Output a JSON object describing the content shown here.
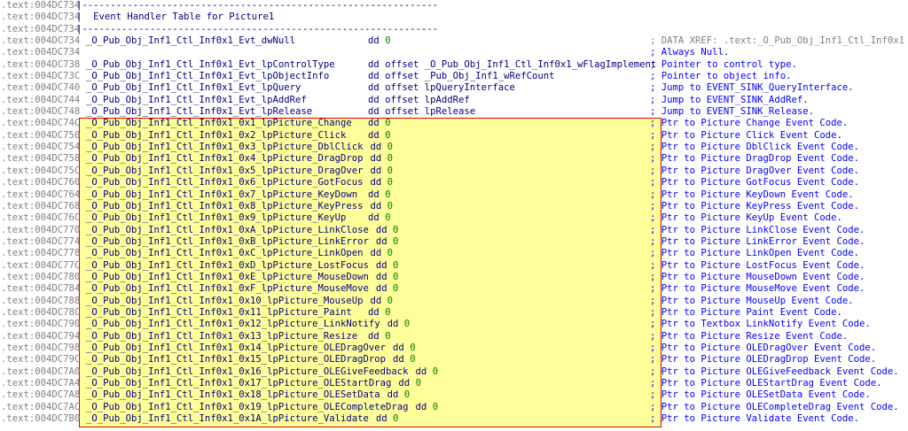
{
  "header": {
    "top_rule": "|---------------------------------------------------------------",
    "title": "|  Event Handler Table for Picture1",
    "bottom_rule": "|---------------------------------------------------------------"
  },
  "rows": [
    {
      "addr": ".text:004DC734",
      "kind": "rule",
      "text": "|---------------------------------------------------------------"
    },
    {
      "addr": ".text:004DC734",
      "kind": "rule",
      "text": "|  Event Handler Table for Picture1"
    },
    {
      "addr": ".text:004DC734",
      "kind": "rule",
      "text": "|---------------------------------------------------------------"
    },
    {
      "addr": ".text:004DC734",
      "kind": "code",
      "label": "_O_Pub_Obj_Inf1_Ctl_Inf0x1_Evt_dwNull",
      "op": "dd ",
      "num": "0",
      "operand": "",
      "comment": "; DATA XREF: .text:_O_Pub_Obj_Inf1_Ctl_Inf0x1",
      "comment_style": "xref"
    },
    {
      "addr": ".text:004DC734",
      "kind": "code",
      "label": "",
      "op": "",
      "num": "",
      "operand": "",
      "comment": "; Always Null.",
      "comment_style": "normal"
    },
    {
      "addr": ".text:004DC738",
      "kind": "code",
      "label": "_O_Pub_Obj_Inf1_Ctl_Inf0x1_Evt_lpControlType",
      "op": "dd offset _O_Pub_Obj_Inf1_Ctl_Inf0x1_wFlagImplement",
      "num": "",
      "operand": "",
      "comment": "; Pointer to control type.",
      "comment_style": "normal"
    },
    {
      "addr": ".text:004DC73C",
      "kind": "code",
      "label": "_O_Pub_Obj_Inf1_Ctl_Inf0x1_Evt_lpObjectInfo",
      "op": "dd offset _Pub_Obj_Inf1_wRefCount",
      "num": "",
      "operand": "",
      "comment": "; Pointer to object info.",
      "comment_style": "normal"
    },
    {
      "addr": ".text:004DC740",
      "kind": "code",
      "label": "_O_Pub_Obj_Inf1_Ctl_Inf0x1_Evt_lpQuery",
      "op": "dd offset lpQueryInterface",
      "num": "",
      "operand": "",
      "comment": "; Jump to EVENT_SINK_QueryInterface.",
      "comment_style": "normal"
    },
    {
      "addr": ".text:004DC744",
      "kind": "code",
      "label": "_O_Pub_Obj_Inf1_Ctl_Inf0x1_Evt_lpAddRef",
      "op": "dd offset lpAddRef",
      "num": "",
      "operand": "",
      "comment": "; Jump to EVENT_SINK_AddRef.",
      "comment_style": "normal"
    },
    {
      "addr": ".text:004DC748",
      "kind": "code",
      "label": "_O_Pub_Obj_Inf1_Ctl_Inf0x1_Evt_lpRelease",
      "op": "dd offset lpRelease",
      "num": "",
      "operand": "",
      "comment": "; Jump to EVENT_SINK_Release.",
      "comment_style": "normal"
    },
    {
      "addr": ".text:004DC74C",
      "kind": "hl",
      "label": "_O_Pub_Obj_Inf1_Ctl_Inf0x1_0x1_lpPicture_Change",
      "op": "dd ",
      "num": "0",
      "comment": "; Ptr to Picture Change Event Code."
    },
    {
      "addr": ".text:004DC750",
      "kind": "hl",
      "label": "_O_Pub_Obj_Inf1_Ctl_Inf0x1_0x2_lpPicture_Click",
      "op": "dd ",
      "num": "0",
      "comment": "; Ptr to Picture Click Event Code."
    },
    {
      "addr": ".text:004DC754",
      "kind": "hl",
      "label": "_O_Pub_Obj_Inf1_Ctl_Inf0x1_0x3_lpPicture_DblClick",
      "op": "dd ",
      "num": "0",
      "comment": "; Ptr to Picture DblClick Event Code."
    },
    {
      "addr": ".text:004DC758",
      "kind": "hl",
      "label": "_O_Pub_Obj_Inf1_Ctl_Inf0x1_0x4_lpPicture_DragDrop",
      "op": "dd ",
      "num": "0",
      "comment": "; Ptr to Picture DragDrop Event Code."
    },
    {
      "addr": ".text:004DC75C",
      "kind": "hl",
      "label": "_O_Pub_Obj_Inf1_Ctl_Inf0x1_0x5_lpPicture_DragOver",
      "op": "dd ",
      "num": "0",
      "comment": "; Ptr to Picture DragOver Event Code."
    },
    {
      "addr": ".text:004DC760",
      "kind": "hl",
      "label": "_O_Pub_Obj_Inf1_Ctl_Inf0x1_0x6_lpPicture_GotFocus",
      "op": "dd ",
      "num": "0",
      "comment": "; Ptr to Picture GotFocus Event Code."
    },
    {
      "addr": ".text:004DC764",
      "kind": "hl",
      "label": "_O_Pub_Obj_Inf1_Ctl_Inf0x1_0x7_lpPicture_KeyDown",
      "op": "dd ",
      "num": "0",
      "comment": "; Ptr to Picture KeyDown Event Code."
    },
    {
      "addr": ".text:004DC768",
      "kind": "hl",
      "label": "_O_Pub_Obj_Inf1_Ctl_Inf0x1_0x8_lpPicture_KeyPress",
      "op": "dd ",
      "num": "0",
      "comment": "; Ptr to Picture KeyPress Event Code."
    },
    {
      "addr": ".text:004DC76C",
      "kind": "hl",
      "label": "_O_Pub_Obj_Inf1_Ctl_Inf0x1_0x9_lpPicture_KeyUp",
      "op": "dd ",
      "num": "0",
      "comment": "; Ptr to Picture KeyUp Event Code."
    },
    {
      "addr": ".text:004DC770",
      "kind": "hl",
      "label": "_O_Pub_Obj_Inf1_Ctl_Inf0x1_0xA_lpPicture_LinkClose",
      "op": "dd ",
      "num": "0",
      "comment": "; Ptr to Picture LinkClose Event Code."
    },
    {
      "addr": ".text:004DC774",
      "kind": "hl",
      "label": "_O_Pub_Obj_Inf1_Ctl_Inf0x1_0xB_lpPicture_LinkError",
      "op": "dd ",
      "num": "0",
      "comment": "; Ptr to Picture LinkError Event Code."
    },
    {
      "addr": ".text:004DC778",
      "kind": "hl",
      "label": "_O_Pub_Obj_Inf1_Ctl_Inf0x1_0xC_lpPicture_LinkOpen",
      "op": "dd ",
      "num": "0",
      "comment": "; Ptr to Picture LinkOpen Event Code."
    },
    {
      "addr": ".text:004DC77C",
      "kind": "hl",
      "label": "_O_Pub_Obj_Inf1_Ctl_Inf0x1_0xD_lpPicture_LostFocus",
      "op": "dd ",
      "num": "0",
      "comment": "; Ptr to Picture LostFocus Event Code."
    },
    {
      "addr": ".text:004DC780",
      "kind": "hl",
      "label": "_O_Pub_Obj_Inf1_Ctl_Inf0x1_0xE_lpPicture_MouseDown",
      "op": "dd ",
      "num": "0",
      "comment": "; Ptr to Picture MouseDown Event Code."
    },
    {
      "addr": ".text:004DC784",
      "kind": "hl",
      "label": "_O_Pub_Obj_Inf1_Ctl_Inf0x1_0xF_lpPicture_MouseMove",
      "op": "dd ",
      "num": "0",
      "comment": "; Ptr to Picture MouseMove Event Code."
    },
    {
      "addr": ".text:004DC788",
      "kind": "hl",
      "label": "_O_Pub_Obj_Inf1_Ctl_Inf0x1_0x10_lpPicture_MouseUp",
      "op": "dd ",
      "num": "0",
      "comment": "; Ptr to Picture MouseUp Event Code."
    },
    {
      "addr": ".text:004DC78C",
      "kind": "hl",
      "label": "_O_Pub_Obj_Inf1_Ctl_Inf0x1_0x11_lpPicture_Paint",
      "op": "dd ",
      "num": "0",
      "comment": "; Ptr to Picture Paint Event Code."
    },
    {
      "addr": ".text:004DC790",
      "kind": "hl",
      "label": "_O_Pub_Obj_Inf1_Ctl_Inf0x1_0x12_lpPicture_LinkNotify",
      "op": "dd ",
      "num": "0",
      "comment": "; Ptr to Textbox LinkNotify Event Code."
    },
    {
      "addr": ".text:004DC794",
      "kind": "hl",
      "label": "_O_Pub_Obj_Inf1_Ctl_Inf0x1_0x13_lpPicture_Resize",
      "op": "dd ",
      "num": "0",
      "comment": "; Ptr to Picture Resize Event Code."
    },
    {
      "addr": ".text:004DC798",
      "kind": "hl",
      "label": "_O_Pub_Obj_Inf1_Ctl_Inf0x1_0x14_lpPicture_OLEDragOver",
      "op": "dd ",
      "num": "0",
      "comment": "; Ptr to Picture OLEDragOver Event Code."
    },
    {
      "addr": ".text:004DC79C",
      "kind": "hl",
      "label": "_O_Pub_Obj_Inf1_Ctl_Inf0x1_0x15_lpPicture_OLEDragDrop",
      "op": "dd ",
      "num": "0",
      "comment": "; Ptr to Picture OLEDragDrop Event Code."
    },
    {
      "addr": ".text:004DC7A0",
      "kind": "hl",
      "label": "_O_Pub_Obj_Inf1_Ctl_Inf0x1_0x16_lpPicture_OLEGiveFeedback",
      "op": "dd ",
      "num": "0",
      "comment": "; Ptr to Picture OLEGiveFeedback Event Code."
    },
    {
      "addr": ".text:004DC7A4",
      "kind": "hl",
      "label": "_O_Pub_Obj_Inf1_Ctl_Inf0x1_0x17_lpPicture_OLEStartDrag",
      "op": "dd ",
      "num": "0",
      "comment": "; Ptr to Picture OLEStartDrag Event Code."
    },
    {
      "addr": ".text:004DC7A8",
      "kind": "hl",
      "label": "_O_Pub_Obj_Inf1_Ctl_Inf0x1_0x18_lpPicture_OLESetData",
      "op": "dd ",
      "num": "0",
      "comment": "; Ptr to Picture OLESetData Event Code."
    },
    {
      "addr": ".text:004DC7AC",
      "kind": "hl",
      "label": "_O_Pub_Obj_Inf1_Ctl_Inf0x1_0x19_lpPicture_OLECompleteDrag",
      "op": "dd ",
      "num": "0",
      "comment": "; Ptr to Picture OLECompleteDrag Event Code."
    },
    {
      "addr": ".text:004DC7B0",
      "kind": "hl",
      "label": "_O_Pub_Obj_Inf1_Ctl_Inf0x1_0x1A_lpPicture_Validate",
      "op": "dd ",
      "num": "0",
      "comment": "; Ptr to Picture Validate Event Code."
    }
  ],
  "colors": {
    "address": "#808080",
    "code": "#000080",
    "number": "#008000",
    "comment": "#0000ff",
    "highlight_fill": "#ffff99",
    "highlight_border": "#e00000"
  }
}
